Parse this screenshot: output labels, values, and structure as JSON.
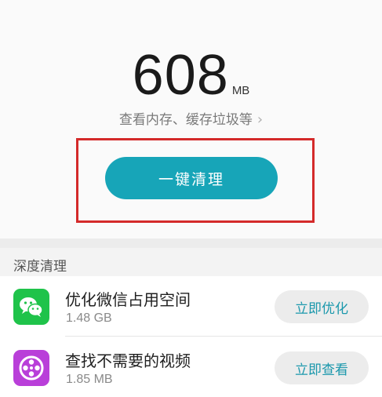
{
  "storage": {
    "value": "608",
    "unit": "MB",
    "detail_link": "查看内存、缓存垃圾等"
  },
  "clean_button": {
    "label": "一键清理"
  },
  "deep_clean": {
    "title": "深度清理",
    "items": [
      {
        "name": "优化微信占用空间",
        "size": "1.48 GB",
        "action": "立即优化",
        "icon": "wechat-icon"
      },
      {
        "name": "查找不需要的视频",
        "size": "1.85 MB",
        "action": "立即查看",
        "icon": "video-icon"
      }
    ]
  },
  "colors": {
    "accent": "#17a5b8",
    "highlight": "#d42a2a",
    "wechat_green": "#1fc34a",
    "video_purple": "#b93fd9"
  }
}
